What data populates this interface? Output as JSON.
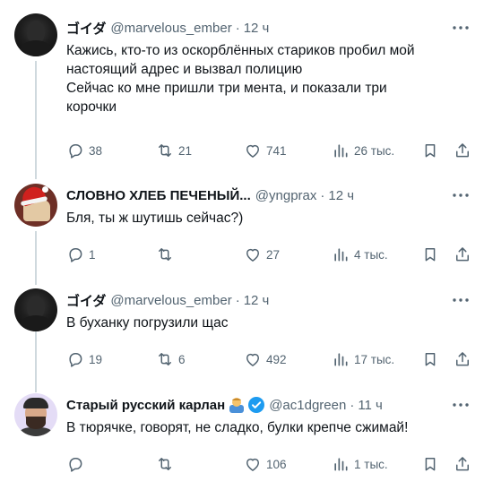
{
  "tweets": [
    {
      "name": "ゴイダ",
      "handle": "@marvelous_ember",
      "time": "12 ч",
      "lines": [
        "Кажись, кто-то из оскорблённых стариков пробил мой",
        "настоящий адрес и вызвал полицию",
        "Сейчас ко мне пришли три мента, и показали три",
        "корочки"
      ],
      "replies": "38",
      "retweets": "21",
      "likes": "741",
      "views": "26 тыс."
    },
    {
      "name": "СЛОВНО ХЛЕБ ПЕЧЕНЫЙ...",
      "handle": "@yngprax",
      "time": "12 ч",
      "lines": [
        "Бля, ты ж шутишь сейчас?)"
      ],
      "replies": "1",
      "retweets": "",
      "likes": "27",
      "views": "4 тыс."
    },
    {
      "name": "ゴイダ",
      "handle": "@marvelous_ember",
      "time": "12 ч",
      "lines": [
        "В буханку погрузили щас"
      ],
      "replies": "19",
      "retweets": "6",
      "likes": "492",
      "views": "17 тыс."
    },
    {
      "name": "Старый русский карлан",
      "handle": "@ac1dgreen",
      "time": "11 ч",
      "lines": [
        "В тюрячке, говорят, не сладко, булки крепче сжимай!"
      ],
      "replies": "",
      "retweets": "",
      "likes": "106",
      "views": "1 тыс."
    }
  ],
  "colors": {
    "text": "#0f1419",
    "muted": "#536471",
    "line": "#cfd9de",
    "verified": "#1d9bf0"
  },
  "icons": [
    "more-icon",
    "reply-icon",
    "retweet-icon",
    "like-icon",
    "views-icon",
    "bookmark-icon",
    "share-icon",
    "verified-badge-icon"
  ]
}
